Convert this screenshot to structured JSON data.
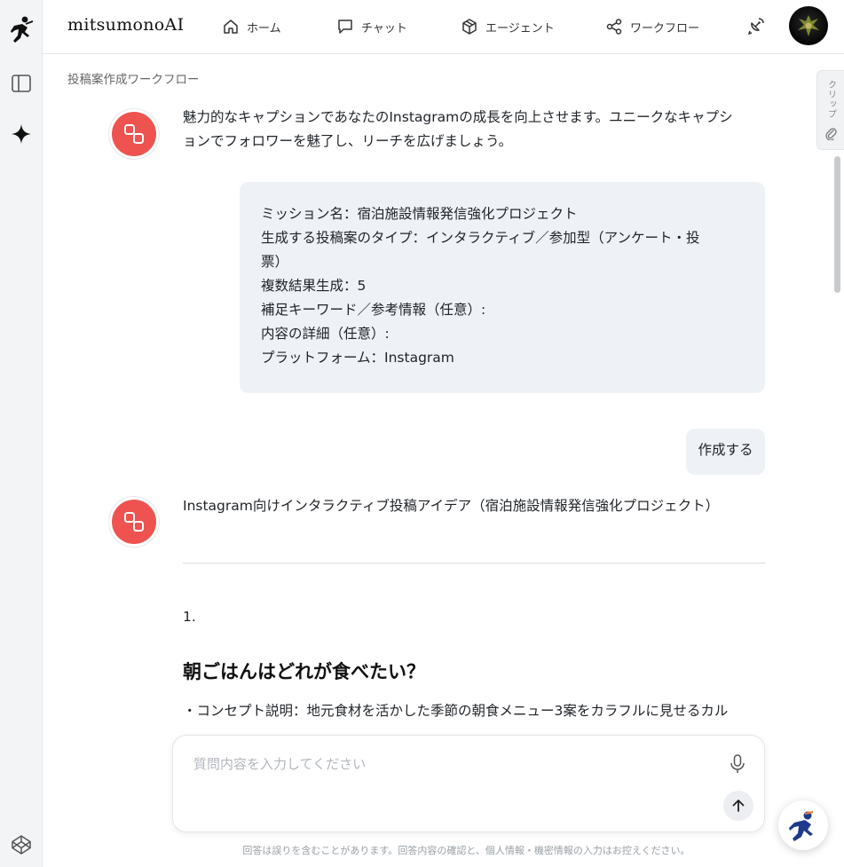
{
  "header": {
    "brand": "mitsumonoAI",
    "nav": [
      {
        "label": "ホーム",
        "icon": "home-icon"
      },
      {
        "label": "チャット",
        "icon": "chat-icon"
      },
      {
        "label": "エージェント",
        "icon": "cube-icon"
      },
      {
        "label": "ワークフロー",
        "icon": "share-nodes-icon"
      }
    ]
  },
  "breadcrumb": "投稿案作成ワークフロー",
  "messages": {
    "bot1": {
      "lines": [
        "魅力的なキャプションであなたのInstagramの成長を向上させます。ユニークなキャプシ",
        "ョンでフォロワーを魅了し、リーチを広げましょう。"
      ]
    },
    "user1": {
      "lines": [
        "ミッション名：宿泊施設情報発信強化プロジェクト",
        "生成する投稿案のタイプ：インタラクティブ／参加型（アンケート・投",
        "票）",
        "複数結果生成：5",
        "補足キーワード／参考情報（任意）:",
        "内容の詳細（任意）:",
        "プラットフォーム：Instagram"
      ]
    },
    "user2": {
      "text": "作成する"
    },
    "bot2": {
      "title": "Instagram向けインタラクティブ投稿アイデア（宿泊施設情報発信強化プロジェクト）",
      "item_number": "1.",
      "heading": "朝ごはんはどれが食べたい？",
      "concept": "・コンセプト説明：地元食材を活かした季節の朝食メニュー3案をカラフルに見せるカル"
    }
  },
  "composer": {
    "placeholder": "質問内容を入力してください"
  },
  "disclaimer": "回答は誤りを含むことがあります。回答内容の確認と、個人情報・機密情報の入力はお控えください。",
  "clip_tab": {
    "label": "クリップ"
  },
  "colors": {
    "bot_avatar": "#ef5350",
    "user_bubble": "#eef1f6",
    "rail": "#f3f4f6"
  }
}
